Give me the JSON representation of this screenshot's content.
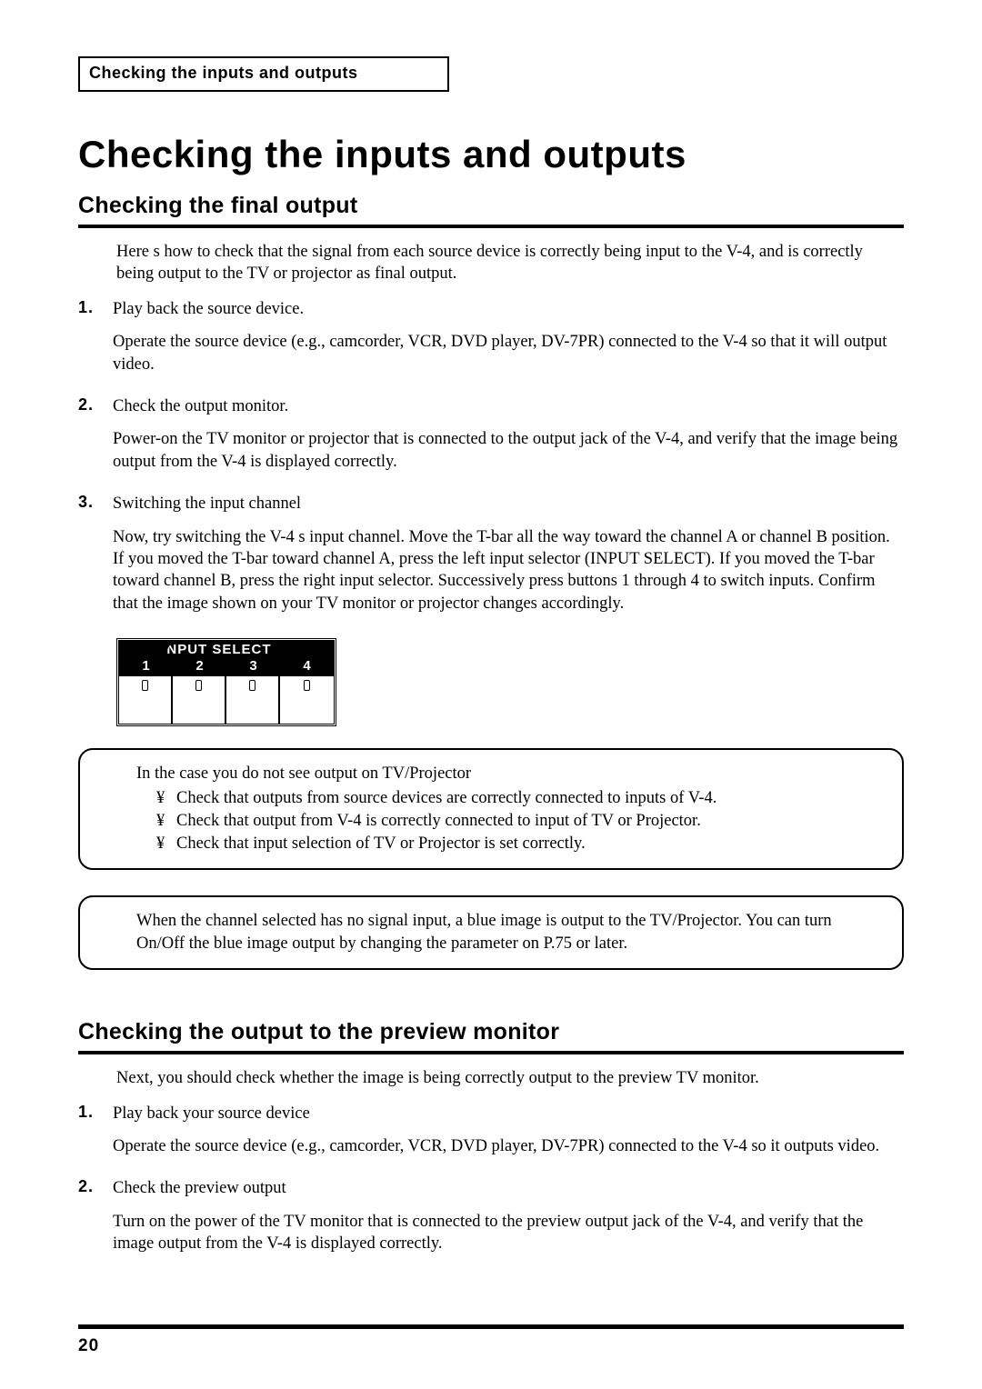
{
  "running_header": "Checking the inputs and outputs",
  "title": "Checking the inputs and outputs",
  "section1": {
    "heading": "Checking the final output",
    "intro": "Here s how to check that the signal from each source device is correctly being input to the V-4, and is correctly being output to the TV or projector as final output.",
    "steps": [
      {
        "num": "1.",
        "lead": "Play back the source device.",
        "detail": "Operate the source device (e.g., camcorder, VCR, DVD player, DV-7PR) connected to the V-4 so that it will output video."
      },
      {
        "num": "2.",
        "lead": "Check the output monitor.",
        "detail": "Power-on the TV monitor or projector that is connected to the output jack of the V-4, and verify that the image being output from the V-4 is displayed correctly."
      },
      {
        "num": "3.",
        "lead": "Switching the input channel",
        "detail": "Now, try switching the V-4 s input channel. Move the T-bar all the way toward the channel A or channel B position. If you moved the T-bar toward channel A, press the left input selector (INPUT SELECT). If you moved the T-bar toward channel B, press the right input selector. Successively press buttons 1 through 4 to switch inputs. Confirm that the image shown on your TV monitor or projector changes accordingly."
      }
    ]
  },
  "panel": {
    "label": "INPUT SELECT",
    "nums": [
      "1",
      "2",
      "3",
      "4"
    ]
  },
  "note1": {
    "lead": "In the case you do not see output on TV/Projector",
    "bullet_glyph": "¥",
    "items": [
      "Check that outputs from source devices are correctly connected to inputs of V-4.",
      "Check that output from V-4 is correctly connected to input of TV or Projector.",
      "Check that input selection of TV or Projector is set correctly."
    ]
  },
  "note2": {
    "para": "When the channel selected has no signal input, a blue image is output to the TV/Projector. You can turn On/Off the blue image output by changing the parameter on P.75 or later."
  },
  "section2": {
    "heading": "Checking the output to the preview monitor",
    "intro": "Next, you should check whether the image is being correctly output to the preview TV monitor.",
    "steps": [
      {
        "num": "1.",
        "lead": "Play back your source device",
        "detail": "Operate the source device (e.g., camcorder, VCR, DVD player, DV-7PR) connected to the V-4 so it outputs video."
      },
      {
        "num": "2.",
        "lead": "Check the preview output",
        "detail": "Turn on the power of the TV monitor that is connected to the preview output jack of the V-4, and verify that the image output from the V-4 is displayed correctly."
      }
    ]
  },
  "page_number": "20"
}
